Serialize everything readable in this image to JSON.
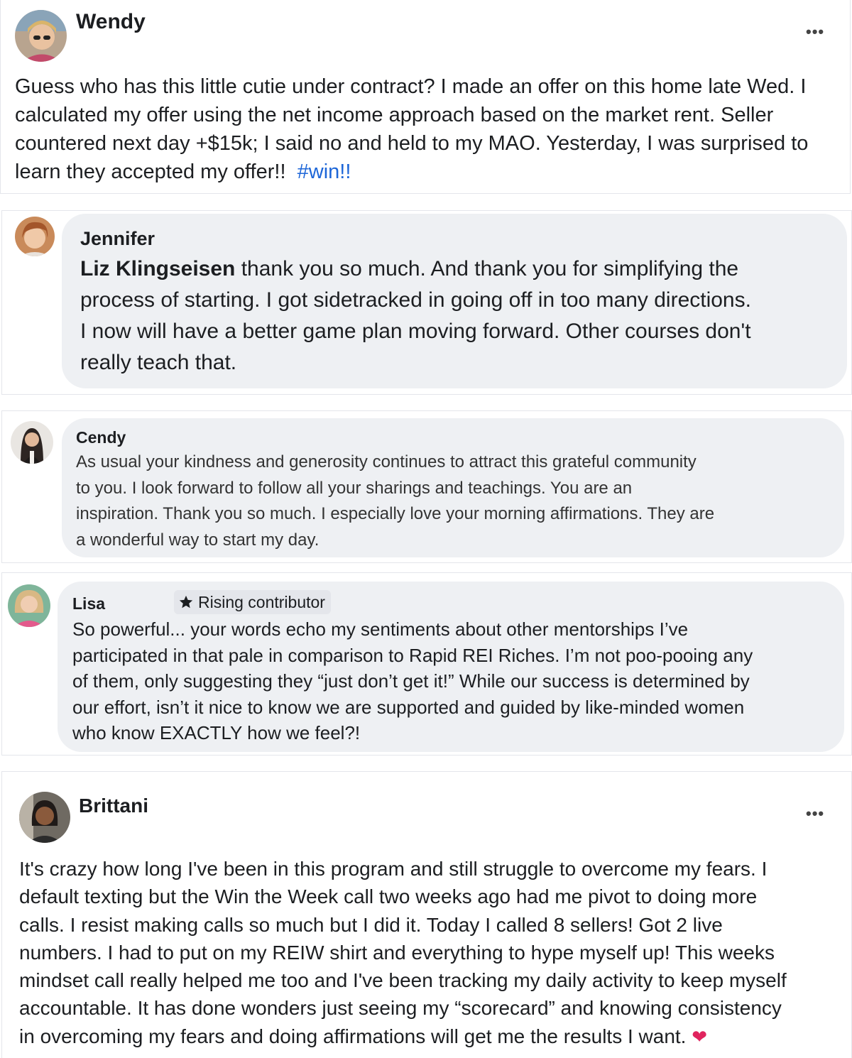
{
  "posts": [
    {
      "name": "Wendy",
      "more_label": "•••",
      "text_lines": [
        "Guess who has this little cutie under contract?  I made an offer on this home late Wed.  I",
        "calculated my offer using the net income approach based on the market rent. Seller",
        "countered next day +$15k; I said no and held to my MAO. Yesterday, I was surprised to"
      ],
      "last_line": "learn they accepted my offer!!  ",
      "hashtag": "#win!!"
    },
    {
      "name": "Brittani",
      "more_label": "•••",
      "text_lines": [
        "It's crazy how long I've been in this program and still struggle to overcome my fears. I",
        "default texting but the Win the Week call two weeks ago had me pivot to doing more",
        "calls. I resist making calls so much but I did it. Today I called 8 sellers! Got 2 live",
        "numbers. I had to put on my REIW shirt and everything to hype myself up! This weeks",
        "mindset call really helped me too and I've been tracking my daily activity to keep myself",
        "accountable. It has done wonders just seeing my “scorecard” and knowing consistency"
      ],
      "last_line": "in overcoming my fears and doing affirmations will get me the results I want. ",
      "emoji": "❤"
    }
  ],
  "comments": [
    {
      "name": "Jennifer",
      "mention": "Liz Klingseisen",
      "first_rest": " thank you so much. And thank you for simplifying the",
      "text_lines": [
        "process of starting. I got sidetracked in going off in too many directions.",
        "I now will have a better game plan moving forward. Other courses don't",
        "really teach that."
      ]
    },
    {
      "name": "Cendy",
      "text_lines": [
        "As usual your kindness and generosity continues to attract this grateful community",
        "to you. I look forward to follow all your sharings and teachings. You are an",
        "inspiration. Thank you so much. I especially love your morning affirmations. They are",
        "a wonderful way to start my day."
      ]
    },
    {
      "name": "Lisa",
      "badge": "Rising contributor",
      "badge_icon": "star-icon",
      "text_lines": [
        "So powerful... your words echo my sentiments about other mentorships I’ve",
        "participated in that pale in comparison to Rapid REI Riches. I’m not poo-pooing any",
        "of them, only suggesting they “just don’t get it!” While our success is determined by",
        "our effort, isn’t it nice to know we are supported and guided by like-minded women",
        "who know EXACTLY how we feel?!"
      ]
    }
  ]
}
